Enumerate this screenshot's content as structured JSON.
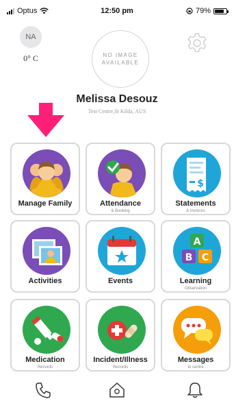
{
  "status_bar": {
    "carrier": "Optus",
    "time": "12:50 pm",
    "battery_percent": "79%",
    "battery_level": 0.79
  },
  "weather": {
    "condition": "NA",
    "temperature": "0° C"
  },
  "profile": {
    "photo_placeholder_line1": "NO IMAGE",
    "photo_placeholder_line2": "AVAILABLE",
    "name": "Melissa Desouz",
    "location": "Test Centre,St Kilda, AUS"
  },
  "colors": {
    "arrow": "#ff1f77",
    "tile_border": "#d8d8d8"
  },
  "menu": [
    {
      "label": "Manage Family",
      "sub": "",
      "icon": "family-icon"
    },
    {
      "label": "Attendance",
      "sub": "& Booking",
      "icon": "attendance-icon"
    },
    {
      "label": "Statements",
      "sub": "& Invoices",
      "icon": "statements-icon"
    },
    {
      "label": "Activities",
      "sub": "",
      "icon": "photos-icon"
    },
    {
      "label": "Events",
      "sub": "",
      "icon": "calendar-icon"
    },
    {
      "label": "Learning",
      "sub": "Observation",
      "icon": "abc-blocks-icon"
    },
    {
      "label": "Medication",
      "sub": "Records",
      "icon": "medication-icon"
    },
    {
      "label": "Incident/Illness",
      "sub": "Records",
      "icon": "first-aid-icon"
    },
    {
      "label": "Messages",
      "sub": "to centre",
      "icon": "chat-icon"
    }
  ],
  "tab_bar": [
    "phone-icon",
    "home-icon",
    "bell-icon"
  ]
}
